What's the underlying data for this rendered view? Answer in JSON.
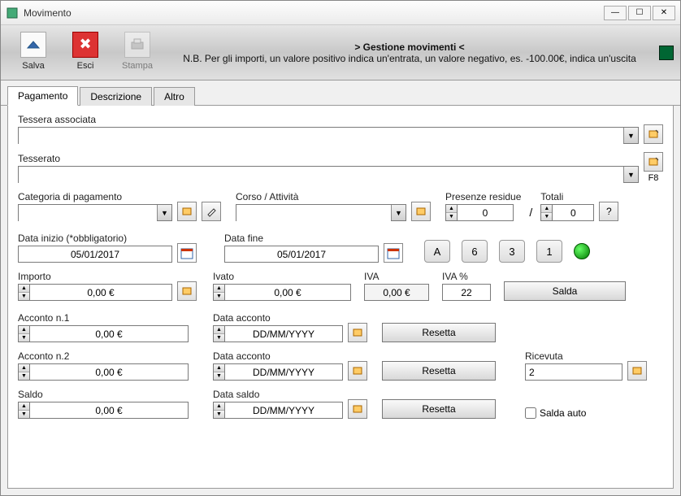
{
  "window": {
    "title": "Movimento"
  },
  "toolbar": {
    "save": "Salva",
    "exit": "Esci",
    "print": "Stampa",
    "header_title": "> Gestione movimenti <",
    "header_note": "N.B. Per gli importi, un valore positivo indica un'entrata, un valore negativo, es. -100.00€, indica un'uscita"
  },
  "tabs": {
    "pagamento": "Pagamento",
    "descrizione": "Descrizione",
    "altro": "Altro"
  },
  "labels": {
    "tessera": "Tessera associata",
    "tesserato": "Tesserato",
    "f8": "F8",
    "categoria": "Categoria di pagamento",
    "corso": "Corso / Attività",
    "presenze": "Presenze residue",
    "totali": "Totali",
    "data_inizio": "Data inizio (*obbligatorio)",
    "data_fine": "Data fine",
    "importo": "Importo",
    "ivato": "Ivato",
    "iva": "IVA",
    "iva_pct": "IVA %",
    "salda": "Salda",
    "acconto1": "Acconto n.1",
    "acconto2": "Acconto n.2",
    "data_acconto": "Data acconto",
    "saldo": "Saldo",
    "data_saldo": "Data saldo",
    "resetta": "Resetta",
    "ricevuta": "Ricevuta",
    "salda_auto": "Salda auto",
    "help": "?"
  },
  "buttons": {
    "a": "A",
    "six": "6",
    "three": "3",
    "one": "1"
  },
  "values": {
    "tessera": "",
    "tesserato": "",
    "categoria": "",
    "corso": "",
    "presenze": "0",
    "totali": "0",
    "data_inizio": "05/01/2017",
    "data_fine": "05/01/2017",
    "importo": "0,00 €",
    "ivato": "0,00 €",
    "iva": "0,00 €",
    "iva_pct": "22",
    "acconto1": "0,00 €",
    "data_acconto1": "DD/MM/YYYY",
    "acconto2": "0,00 €",
    "data_acconto2": "DD/MM/YYYY",
    "saldo": "0,00 €",
    "data_saldo": "DD/MM/YYYY",
    "ricevuta": "2"
  }
}
